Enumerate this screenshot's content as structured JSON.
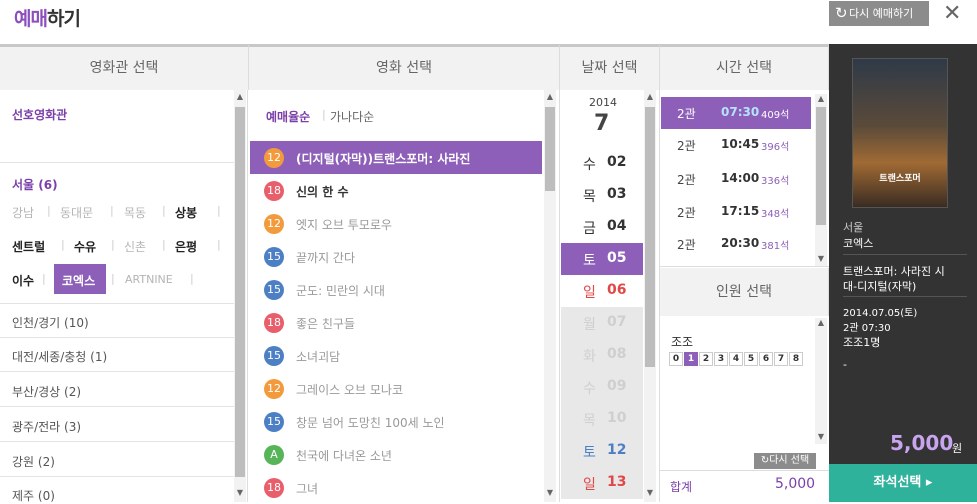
{
  "header": {
    "title_a": "예매",
    "title_b": "하기",
    "reset_label": "다시 예매하기",
    "reset_icon": "↻",
    "close_icon": "✕"
  },
  "columns": {
    "theater": "영화관 선택",
    "movie": "영화 선택",
    "date": "날짜 선택",
    "time": "시간 선택",
    "people": "인원 선택"
  },
  "theater": {
    "favorite": "선호영화관",
    "region_seoul": "서울 (6)",
    "seoul_row1": [
      "강남",
      "동대문",
      "목동",
      "상봉"
    ],
    "seoul_row2": [
      "센트럴",
      "수유",
      "신촌",
      "은평"
    ],
    "seoul_row3": [
      "이수",
      "코엑스",
      "ARTNINE"
    ],
    "regions": [
      "인천/경기 (10)",
      "대전/세종/충청 (1)",
      "부산/경상 (2)",
      "광주/전라 (3)",
      "강원 (2)",
      "제주 (0)"
    ]
  },
  "movie": {
    "sort_by_booking": "예매율순",
    "sort_by_name": "가나다순",
    "list": [
      {
        "age": "12",
        "title": "(디지털(자막))트랜스포머: 사라진",
        "color": "#f39b3c"
      },
      {
        "age": "18",
        "title": "신의 한 수",
        "color": "#e95e6b"
      },
      {
        "age": "12",
        "title": "엣지 오브 투모로우",
        "color": "#f39b3c"
      },
      {
        "age": "15",
        "title": "끝까지 간다",
        "color": "#4d7fc4"
      },
      {
        "age": "15",
        "title": "군도: 민란의 시대",
        "color": "#4d7fc4"
      },
      {
        "age": "18",
        "title": "좋은 친구들",
        "color": "#e95e6b"
      },
      {
        "age": "15",
        "title": "소녀괴담",
        "color": "#4d7fc4"
      },
      {
        "age": "12",
        "title": "그레이스 오브 모나코",
        "color": "#f39b3c"
      },
      {
        "age": "15",
        "title": "창문 넘어 도망친 100세 노인",
        "color": "#4d7fc4"
      },
      {
        "age": "A",
        "title": "천국에 다녀온 소년",
        "color": "#57b458"
      },
      {
        "age": "18",
        "title": "그녀",
        "color": "#e95e6b"
      }
    ]
  },
  "date": {
    "year": "2014",
    "month": "7",
    "list": [
      {
        "dow": "수",
        "day": "02"
      },
      {
        "dow": "목",
        "day": "03"
      },
      {
        "dow": "금",
        "day": "04"
      },
      {
        "dow": "토",
        "day": "05"
      },
      {
        "dow": "일",
        "day": "06"
      },
      {
        "dow": "월",
        "day": "07"
      },
      {
        "dow": "화",
        "day": "08"
      },
      {
        "dow": "수",
        "day": "09"
      },
      {
        "dow": "목",
        "day": "10"
      },
      {
        "dow": "토",
        "day": "12"
      },
      {
        "dow": "일",
        "day": "13"
      }
    ]
  },
  "time": {
    "list": [
      {
        "hall": "2관",
        "time": "07:30",
        "seats": "409석"
      },
      {
        "hall": "2관",
        "time": "10:45",
        "seats": "396석"
      },
      {
        "hall": "2관",
        "time": "14:00",
        "seats": "336석"
      },
      {
        "hall": "2관",
        "time": "17:15",
        "seats": "348석"
      },
      {
        "hall": "2관",
        "time": "20:30",
        "seats": "381석"
      }
    ]
  },
  "people": {
    "category": "조조",
    "numbers": [
      "0",
      "1",
      "2",
      "3",
      "4",
      "5",
      "6",
      "7",
      "8"
    ],
    "selected": "1",
    "reselect": "다시 선택",
    "total_label": "합계",
    "total": "5,000"
  },
  "summary": {
    "region": "서울",
    "theater": "코엑스",
    "movie_line1": "트랜스포머: 사라진 시",
    "movie_line2": "대-디지털(자막)",
    "date": "2014.07.05(토)",
    "time": "2관 07:30",
    "people": "조조1명",
    "dash": "-",
    "price": "5,000",
    "won": "원",
    "poster_title": "트랜스포머",
    "seat_button": "좌석선택 ▸"
  },
  "colors": {
    "accent": "#8d5fb8",
    "teal": "#2fb29b",
    "summary_bg": "#333333",
    "sat": "#4d7fc4",
    "sun": "#e04848"
  }
}
